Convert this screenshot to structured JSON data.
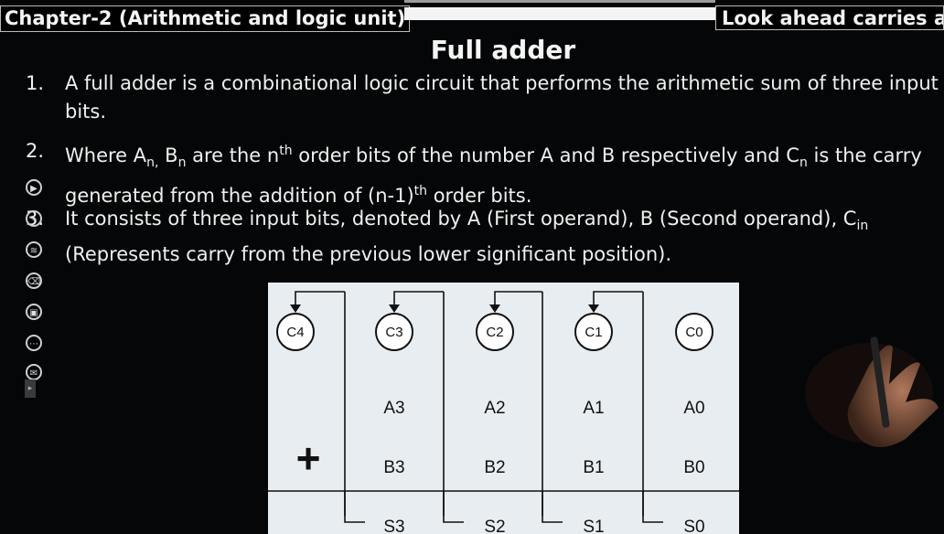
{
  "header": {
    "chapter": "Chapter-2 (Arithmetic and logic unit)",
    "right_label": "Look ahead carries ad",
    "title": "Full adder"
  },
  "points": [
    {
      "num": "1.",
      "text": "A full adder is a combinational logic circuit that performs the arithmetic sum of three input bits."
    },
    {
      "num": "2.",
      "line1_pre": "Where A",
      "sub_a": "n,",
      "mid1": " B",
      "sub_b": "n",
      "mid2": " are the n",
      "sup_th": "th",
      "mid3": " order bits of the number A and B respectively and C",
      "sub_c": "n",
      "mid4": " is the carry",
      "line2_pre": "generated from the addition of (n-1)",
      "sup_th2": "th",
      "line2_post": " order bits."
    },
    {
      "num": "3.",
      "line1": "It consists of three input bits, denoted by A (First operand), B (Second operand), C",
      "sub_in": "in",
      "line2": "(Represents carry from the previous lower significant position)."
    }
  ],
  "diagram": {
    "carries": [
      "C4",
      "C3",
      "C2",
      "C1",
      "C0"
    ],
    "a_row": [
      "A3",
      "A2",
      "A1",
      "A0"
    ],
    "b_row": [
      "B3",
      "B2",
      "B1",
      "B0"
    ],
    "s_row": [
      "S3",
      "S2",
      "S1",
      "S0"
    ],
    "operator": "+"
  },
  "sidebar_icons": [
    "play-icon",
    "pen-icon",
    "highlighter-icon",
    "eraser-icon",
    "screen-icon",
    "more-icon",
    "chat-icon"
  ],
  "colors": {
    "background": "#050607",
    "text": "#f2f2f2",
    "diagram_bg": "#e8edf1"
  }
}
